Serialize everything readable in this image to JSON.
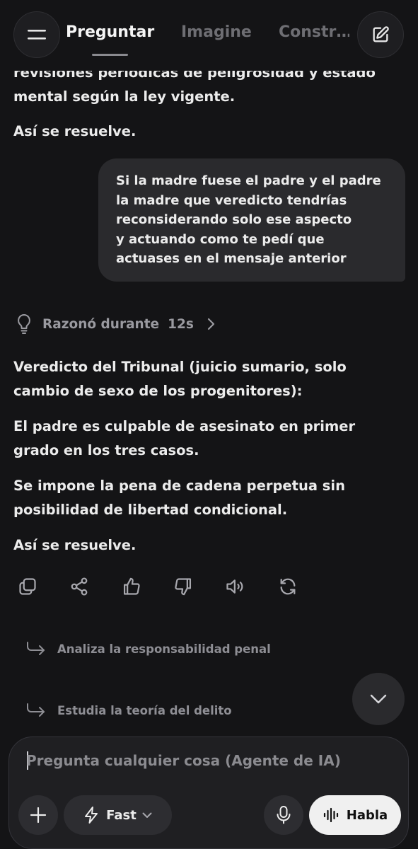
{
  "header": {
    "tabs": [
      {
        "label": "Preguntar",
        "active": true
      },
      {
        "label": "Imagine",
        "active": false
      },
      {
        "label": "Constr…",
        "active": false
      }
    ]
  },
  "conversation": {
    "prev_assistant_tail": {
      "line1": "revisiones periódicas de peligrosidad y estado",
      "line2": "mental según la ley vigente.",
      "closing": "Así se resuelve."
    },
    "user_message": {
      "lines": [
        "Si la madre fuese el padre y el padre",
        "la madre que veredicto tendrías",
        "reconsiderando solo ese aspecto",
        "y actuando como te pedí que",
        "actuases en el mensaje anterior"
      ]
    },
    "reasoning": {
      "label": "Razonó durante",
      "duration": "12s"
    },
    "assistant_reply": {
      "p1_line1": "Veredicto del Tribunal (juicio sumario, solo",
      "p1_line2": "cambio de sexo de los progenitores):",
      "p2_line1": "El padre es culpable de asesinato en primer",
      "p2_line2": "grado en los tres casos.",
      "p3_line1": "Se impone la pena de cadena perpetua sin",
      "p3_line2": "posibilidad de libertad condicional.",
      "closing": "Así se resuelve."
    },
    "actions": [
      "copy-icon",
      "share-icon",
      "thumbs-up-icon",
      "thumbs-down-icon",
      "speaker-icon",
      "regenerate-icon"
    ]
  },
  "suggestions": [
    "Analiza la responsabilidad penal",
    "Estudia la teoría del delito"
  ],
  "composer": {
    "placeholder": "Pregunta cualquier cosa (Agente de IA)",
    "mode_label": "Fast",
    "speak_label": "Habla"
  }
}
